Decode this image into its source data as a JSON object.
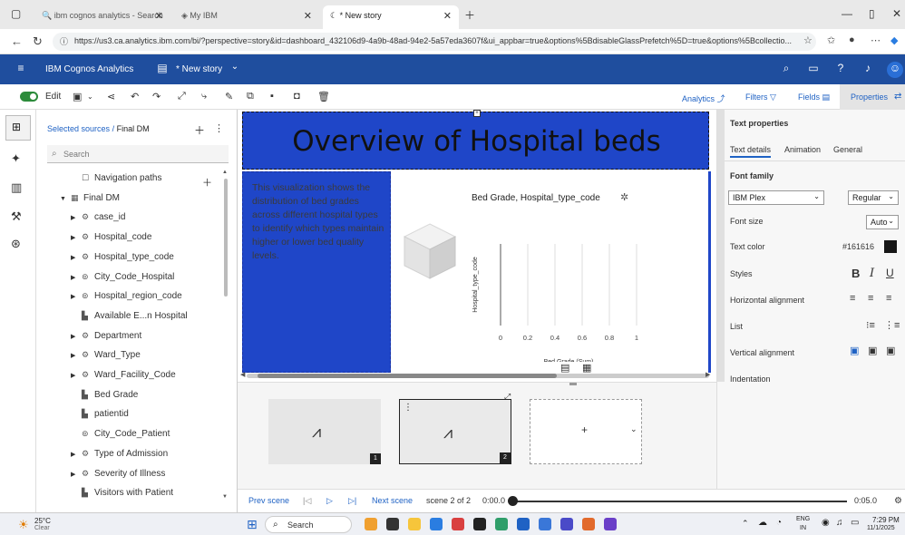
{
  "browser": {
    "tabs": [
      {
        "label": "ibm cognos analytics - Search"
      },
      {
        "label": "My IBM"
      },
      {
        "label": "* New story"
      }
    ],
    "url": "https://us3.ca.analytics.ibm.com/bi/?perspective=story&id=dashboard_432106d9-4a9b-48ad-94e2-5a57eda3607f&ui_appbar=true&options%5BdisableGlassPrefetch%5D=true&options%5Bcollectio..."
  },
  "header": {
    "app_title": "IBM Cognos Analytics",
    "story_title": "* New story"
  },
  "toolbar": {
    "edit_label": "Edit",
    "analytics_label": "Analytics",
    "filters_label": "Filters",
    "fields_label": "Fields",
    "properties_label": "Properties"
  },
  "datapanel": {
    "breadcrumb_link": "Selected sources",
    "breadcrumb_sep": "/",
    "breadcrumb_current": "Final DM",
    "search_placeholder": "Search",
    "items": [
      {
        "label": "Navigation paths",
        "caret": "",
        "icon": "☐"
      },
      {
        "label": "Final DM",
        "caret": "▼",
        "icon": "▦"
      },
      {
        "label": "case_id",
        "caret": "▶",
        "icon": "⚙"
      },
      {
        "label": "Hospital_code",
        "caret": "▶",
        "icon": "⚙"
      },
      {
        "label": "Hospital_type_code",
        "caret": "▶",
        "icon": "⚙"
      },
      {
        "label": "City_Code_Hospital",
        "caret": "▶",
        "icon": "⊚"
      },
      {
        "label": "Hospital_region_code",
        "caret": "▶",
        "icon": "⊚"
      },
      {
        "label": "Available E...n Hospital",
        "caret": "",
        "icon": "▙"
      },
      {
        "label": "Department",
        "caret": "▶",
        "icon": "⚙"
      },
      {
        "label": "Ward_Type",
        "caret": "▶",
        "icon": "⚙"
      },
      {
        "label": "Ward_Facility_Code",
        "caret": "▶",
        "icon": "⚙"
      },
      {
        "label": "Bed Grade",
        "caret": "",
        "icon": "▙"
      },
      {
        "label": "patientid",
        "caret": "",
        "icon": "▙"
      },
      {
        "label": "City_Code_Patient",
        "caret": "",
        "icon": "⊚"
      },
      {
        "label": "Type of Admission",
        "caret": "▶",
        "icon": "⚙"
      },
      {
        "label": "Severity of Illness",
        "caret": "▶",
        "icon": "⚙"
      },
      {
        "label": "Visitors with Patient",
        "caret": "",
        "icon": "▙"
      }
    ]
  },
  "canvas": {
    "title": "Overview of Hospital beds",
    "description": "This visualization shows the distribution of bed grades across different hospital types to identify which types maintain higher or lower bed quality levels."
  },
  "chart_data": {
    "type": "bar",
    "title": "Bed Grade, Hospital_type_code",
    "xlabel": "Bed Grade (Sum)",
    "ylabel": "Hospital_type_code",
    "x_ticks": [
      "0",
      "0.2",
      "0.4",
      "0.6",
      "0.8",
      "1"
    ],
    "xlim": [
      0,
      1
    ],
    "categories": [],
    "values": []
  },
  "scenes": [
    {
      "num": "1"
    },
    {
      "num": "2"
    },
    {
      "add_label": "+"
    }
  ],
  "playback": {
    "prev": "Prev scene",
    "next": "Next scene",
    "scene_count": "scene 2 of 2",
    "time_start": "0:00.0",
    "time_end": "0:05.0",
    "progress": 0.0
  },
  "properties": {
    "title": "Text properties",
    "tabs": [
      "Text details",
      "Animation",
      "General"
    ],
    "font_family_label": "Font family",
    "font_family_value": "IBM Plex",
    "font_weight_value": "Regular",
    "font_size_label": "Font size",
    "font_size_value": "Auto",
    "text_color_label": "Text color",
    "text_color_value": "#161616",
    "styles_label": "Styles",
    "h_align_label": "Horizontal alignment",
    "list_label": "List",
    "v_align_label": "Vertical alignment",
    "indentation_label": "Indentation"
  },
  "taskbar": {
    "weather_temp": "25°C",
    "weather_desc": "Clear",
    "search_placeholder": "Search",
    "lang": "ENG",
    "region": "IN",
    "time": "7:29 PM",
    "date": "11/1/2025"
  },
  "colors": {
    "header": "#1f4e9e",
    "canvas_accent": "#1f46c8",
    "link": "#1f62c4"
  }
}
